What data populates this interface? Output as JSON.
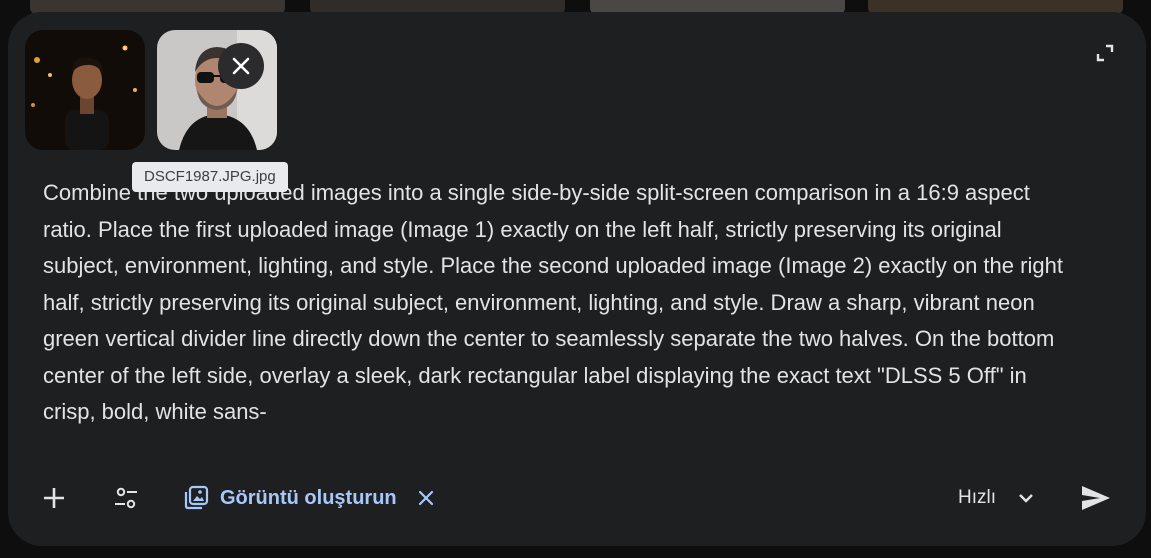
{
  "attachments": [
    {
      "icon": "photo-thumbnail",
      "alt": "uploaded photo 1"
    },
    {
      "icon": "photo-thumbnail",
      "alt": "uploaded photo 2"
    }
  ],
  "tooltip": {
    "filename": "DSCF1987.JPG.jpg"
  },
  "prompt": {
    "text": "Combine the two uploaded images into a single side-by-side split-screen comparison in a 16:9 aspect ratio. Place the first uploaded image (Image 1) exactly on the left half, strictly preserving its original subject, environment, lighting, and style. Place the second uploaded image (Image 2) exactly on the right half, strictly preserving its original subject, environment, lighting, and style. Draw a sharp, vibrant neon green vertical divider line directly down the center to seamlessly separate the two halves. On the bottom center of the left side, overlay a sleek, dark rectangular label displaying the exact text \"DLSS 5 Off\" in crisp, bold, white sans-"
  },
  "toolbar": {
    "add_icon": "plus-icon",
    "tools_icon": "sliders-icon",
    "chip_icon": "image-generate-icon",
    "chip_label": "Görüntü oluşturun",
    "chip_close_icon": "close-icon",
    "mode_label": "Hızlı",
    "mode_icon": "chevron-down-icon",
    "send_icon": "send-icon"
  },
  "colors": {
    "panel_bg": "#1e1f20",
    "page_bg": "#0e0e0f",
    "text": "#e3e3e3",
    "accent": "#a8c7fa"
  }
}
